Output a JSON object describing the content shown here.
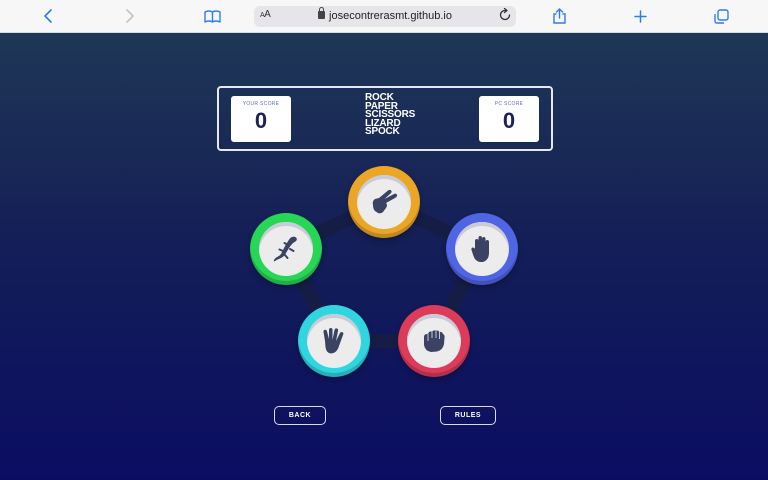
{
  "browser": {
    "url": "josecontrerasmt.github.io",
    "text_size_label_small": "A",
    "text_size_label_large": "A",
    "buttons": [
      "back-icon",
      "forward-icon",
      "bookmarks-icon",
      "reload-icon",
      "share-icon",
      "new-tab-icon",
      "tabs-icon"
    ]
  },
  "scoreboard": {
    "player_label": "YOUR SCORE",
    "player_score": "0",
    "pc_label": "PC SCORE",
    "pc_score": "0",
    "title_lines": [
      "ROCK",
      "PAPER",
      "SCISSORS",
      "LIZARD",
      "SPOCK"
    ]
  },
  "choices": [
    {
      "name": "scissors",
      "icon": "scissors-hand-icon",
      "color": "#eba625"
    },
    {
      "name": "paper",
      "icon": "paper-hand-icon",
      "color": "#5065e3"
    },
    {
      "name": "rock",
      "icon": "rock-fist-icon",
      "color": "#dc3b59"
    },
    {
      "name": "spock",
      "icon": "spock-hand-icon",
      "color": "#2fd6df"
    },
    {
      "name": "lizard",
      "icon": "lizard-icon",
      "color": "#27d654"
    }
  ],
  "buttons": {
    "back": "BACK",
    "rules": "RULES"
  },
  "colors": {
    "background_top": "#1f3756",
    "background_bottom": "#0b0d62",
    "icon_fill": "#3b4263"
  }
}
